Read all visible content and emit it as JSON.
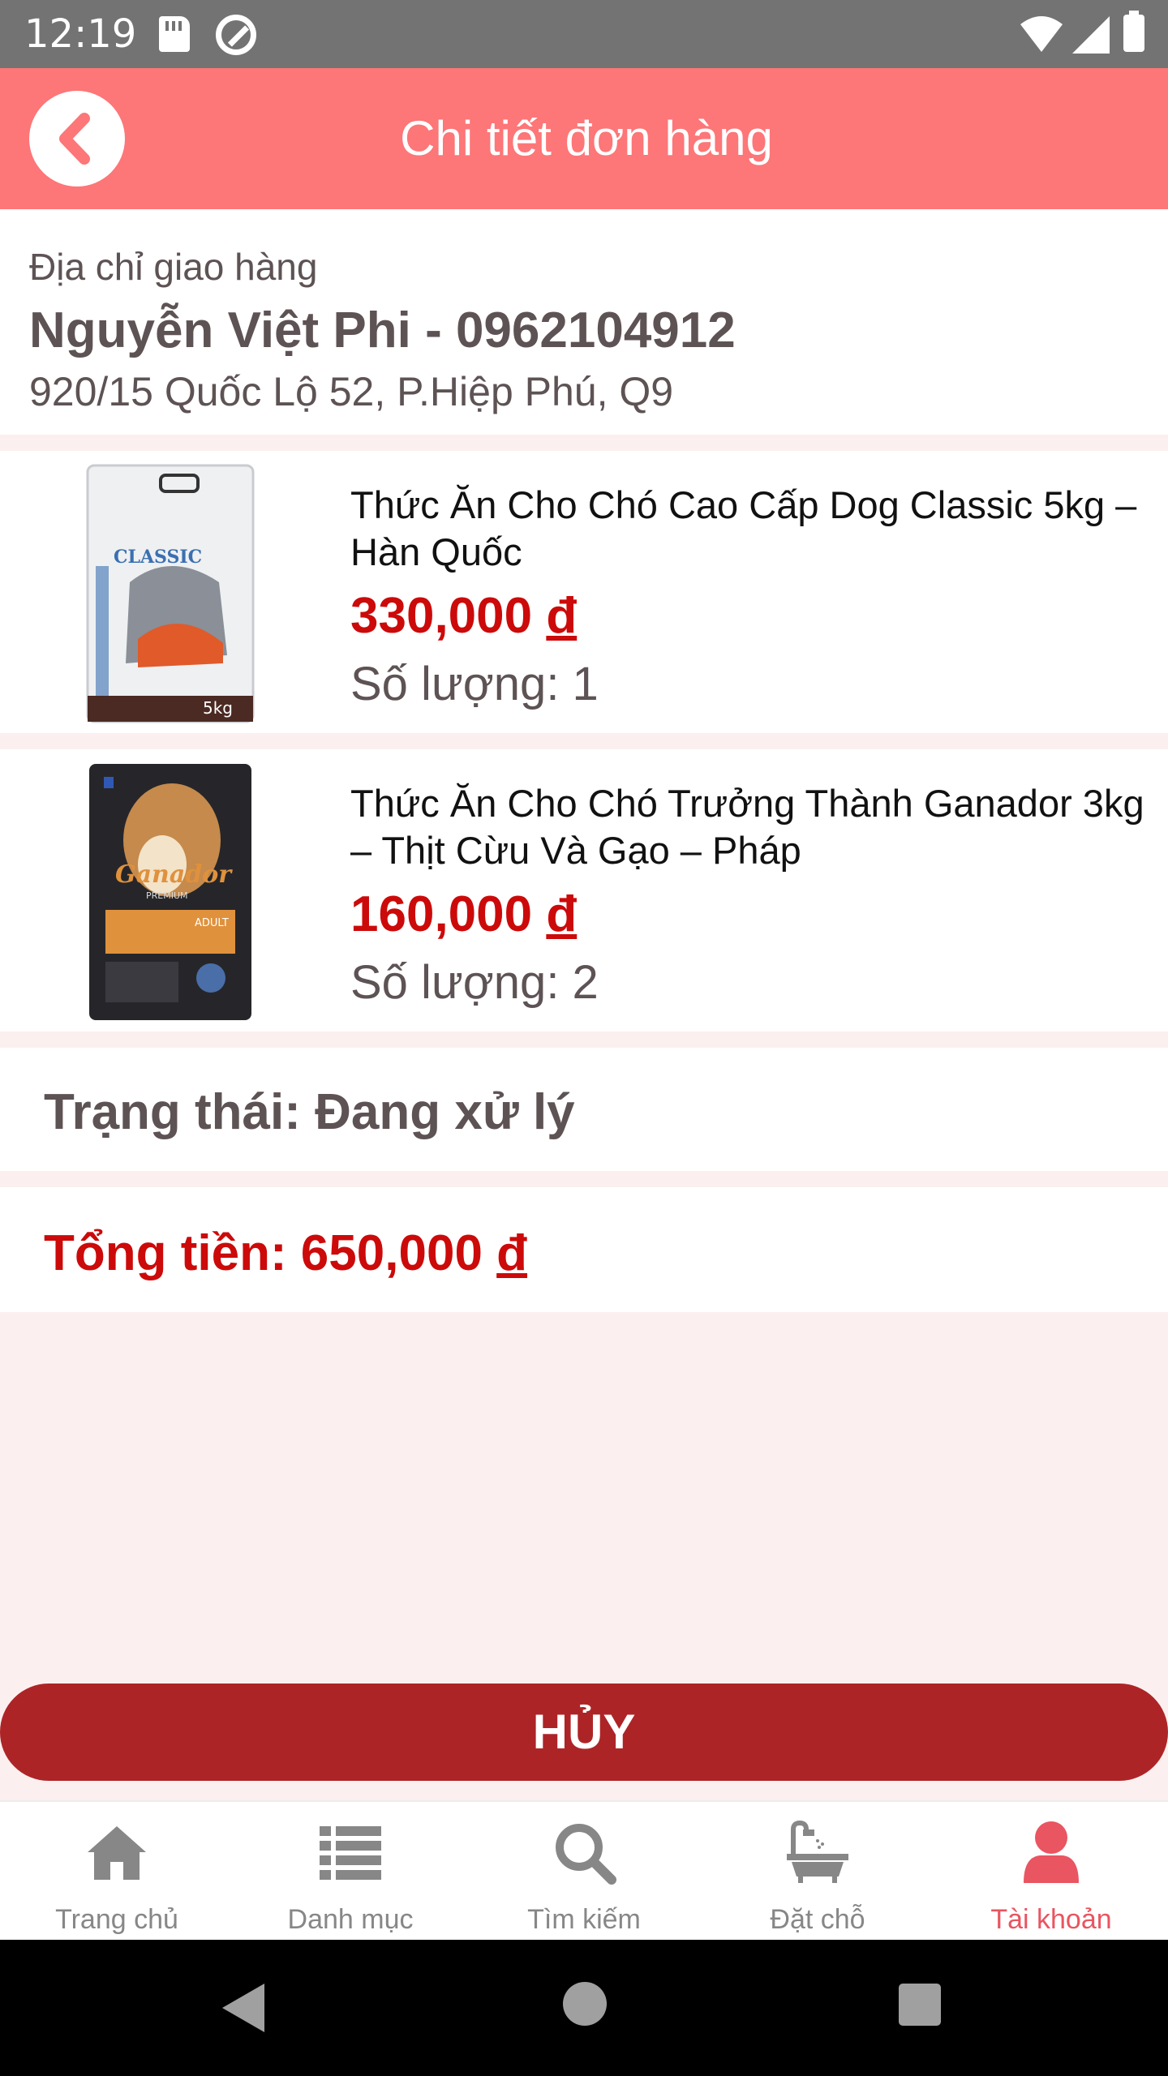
{
  "status_bar": {
    "time": "12:19"
  },
  "header": {
    "title": "Chi tiết đơn hàng",
    "back_icon": "chevron-left-icon"
  },
  "address": {
    "label": "Địa chỉ giao hàng",
    "name_phone": "Nguyễn Việt Phi - 0962104912",
    "line": "920/15 Quốc Lộ 52, P.Hiệp Phú, Q9"
  },
  "products": [
    {
      "name": "Thức Ăn Cho Chó Cao Cấp Dog Classic 5kg – Hàn Quốc",
      "price": "330,000",
      "currency": "đ",
      "quantity": "Số lượng: 1",
      "thumb_colors": {
        "bag": "#eef0f2",
        "accent": "#4a2a22",
        "art": "#e05a2a"
      }
    },
    {
      "name": "Thức Ăn Cho Chó Trưởng Thành Ganador 3kg – Thịt Cừu Và Gạo – Pháp",
      "price": "160,000",
      "currency": "đ",
      "quantity": "Số lượng: 2",
      "thumb_colors": {
        "bag": "#26262a",
        "accent": "#e0913c",
        "art": "#c58a4c"
      }
    }
  ],
  "order_status": "Trạng thái: Đang xử lý",
  "total": {
    "label": "Tổng tiền: 650,000",
    "currency": "đ"
  },
  "cancel_button": "HỦY",
  "bottom_nav": [
    {
      "label": "Trang chủ",
      "icon": "home-icon",
      "active": false
    },
    {
      "label": "Danh mục",
      "icon": "list-icon",
      "active": false
    },
    {
      "label": "Tìm kiếm",
      "icon": "search-icon",
      "active": false
    },
    {
      "label": "Đặt chỗ",
      "icon": "bathtub-icon",
      "active": false
    },
    {
      "label": "Tài khoản",
      "icon": "user-icon",
      "active": true
    }
  ],
  "colors": {
    "header_bg": "#fd7678",
    "price_red": "#cc0a0a",
    "cancel_bg": "#ad2427",
    "nav_active": "#e95560",
    "nav_inactive": "#878787",
    "page_bg": "#fbf0ef"
  }
}
